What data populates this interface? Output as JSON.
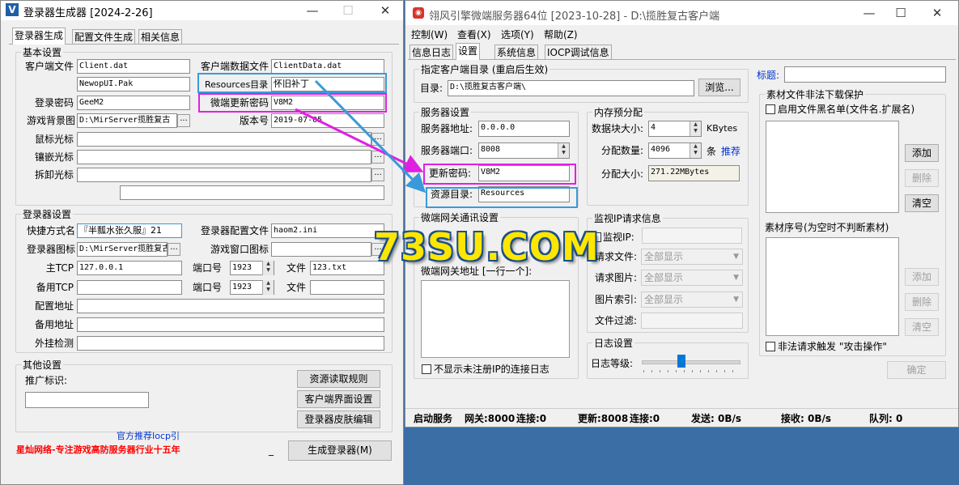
{
  "left_window": {
    "title": "登录器生成器 [2024-2-26]",
    "tabs": [
      "登录器生成",
      "配置文件生成",
      "相关信息"
    ],
    "basic": {
      "group": "基本设置",
      "client_file_label": "客户端文件",
      "client_file": "Client.dat",
      "client_data_label": "客户端数据文件",
      "client_data": "ClientData.dat",
      "pak_file": "NewopUI.Pak",
      "res_dir_label": "Resources目录",
      "res_dir": "怀旧补丁",
      "password_label": "登录密码",
      "password": "GeeM2",
      "update_pwd_label": "微端更新密码",
      "update_pwd": "V8M2",
      "bg_label": "游戏背景图",
      "bg_value": "D:\\MirServer揽胜复古",
      "version_label": "版本号",
      "version": "2019-07-05",
      "cursor_label": "鼠标光标",
      "inlay_label": "镶嵌光标",
      "unload_label": "拆卸光标"
    },
    "login": {
      "group": "登录器设置",
      "shortcut_label": "快捷方式名",
      "shortcut": "『半瓢水张久服』21",
      "config_label": "登录器配置文件",
      "config": "haom2.ini",
      "icon_label": "登录器图标",
      "icon_value": "D:\\MirServer揽胜复古",
      "game_icon_label": "游戏窗口图标",
      "main_tcp_label": "主TCP",
      "main_tcp": "127.0.0.1",
      "port_label": "端口号",
      "port1": "1923",
      "port2": "1923",
      "file_label": "文件",
      "file1": "123.txt",
      "backup_tcp_label": "备用TCP",
      "config_addr_label": "配置地址",
      "backup_addr_label": "备用地址",
      "plugin_label": "外挂检测"
    },
    "other": {
      "group": "其他设置",
      "promo_label": "推广标识:",
      "btn_rules": "资源读取规则",
      "btn_ui": "客户端界面设置",
      "btn_skin": "登录器皮肤编辑"
    },
    "footer": {
      "recommend": "官方推荐Iocp引",
      "slogan": "星灿网络-专注游戏高防服务器行业十五年",
      "dash": "_",
      "generate": "生成登录器(M)"
    }
  },
  "right_window": {
    "title": "翎风引擎微端服务器64位 [2023-10-28] - D:\\揽胜复古客户端",
    "menu": [
      "控制(W)",
      "查看(X)",
      "选项(Y)",
      "帮助(Z)"
    ],
    "tabs": [
      "信息日志",
      "设置",
      "系统信息",
      "IOCP调试信息"
    ],
    "client_dir": {
      "group": "指定客户端目录 (重启后生效)",
      "dir_label": "目录:",
      "dir": "D:\\揽胜复古客户端\\",
      "browse": "浏览..."
    },
    "server": {
      "group": "服务器设置",
      "addr_label": "服务器地址:",
      "addr": "0.0.0.0",
      "port_label": "服务器端口:",
      "port": "8008",
      "pwd_label": "更新密码:",
      "pwd": "V8M2",
      "res_label": "资源目录:",
      "res": "Resources"
    },
    "memory": {
      "group": "内存预分配",
      "block_label": "数据块大小:",
      "block": "4",
      "block_unit": "KBytes",
      "count_label": "分配数量:",
      "count": "4096",
      "count_unit": "条",
      "recommend": "推荐",
      "size_label": "分配大小:",
      "size": "271.22MBytes"
    },
    "gateway": {
      "group": "微端网关通讯设置",
      "addr_label": "微端网关地址 [一行一个]:",
      "hide_unreg": "不显示未注册IP的连接日志"
    },
    "monitor": {
      "group": "监视IP请求信息",
      "ip_label": "监视IP:",
      "req_file_label": "请求文件:",
      "req_img_label": "请求图片:",
      "img_index_label": "图片索引:",
      "file_filter_label": "文件过滤:",
      "all_show": "全部显示"
    },
    "log": {
      "group": "日志设置",
      "level_label": "日志等级:",
      "level": 0.4
    },
    "title_label": "标题:",
    "assets": {
      "group": "素材文件非法下载保护",
      "blacklist_label": "启用文件黑名单(文件名.扩展名)",
      "add": "添加",
      "delete": "删除",
      "clear": "清空",
      "seq_label": "素材序号(为空时不判断素材)",
      "attack_label": "非法请求触发 \"攻击操作\""
    },
    "confirm": "确定",
    "status": {
      "start": "启动服务",
      "gateway": "网关:8000",
      "gw_conn": "连接:0",
      "update": "更新:8008",
      "up_conn": "连接:0",
      "send": "发送: 0B/s",
      "recv": "接收: 0B/s",
      "queue": "队列: 0"
    }
  },
  "watermark": "73SU.COM",
  "colors": {
    "highlight_blue": "#3a9ad9",
    "highlight_magenta": "#e020e0",
    "accent_red": "#ff0000",
    "link_blue": "#0033cc"
  }
}
